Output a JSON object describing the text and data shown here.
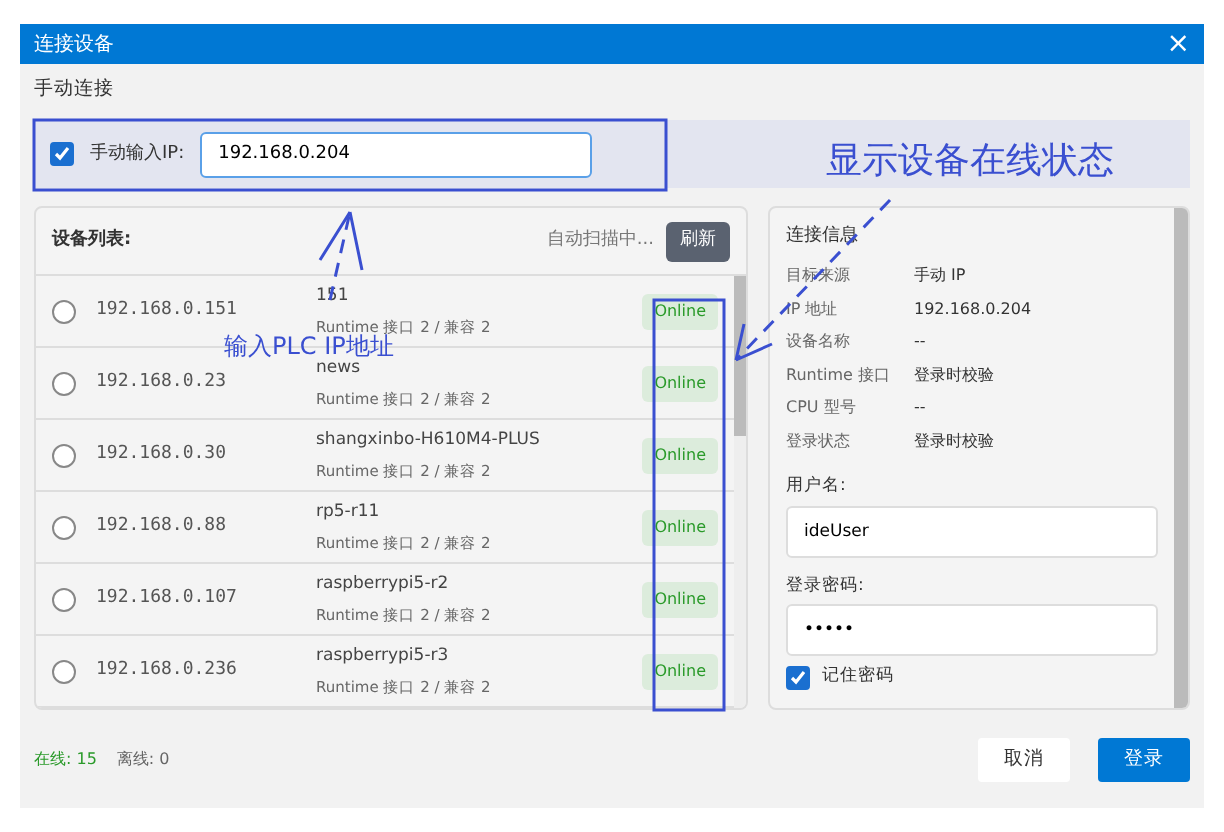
{
  "window": {
    "title": "连接设备",
    "close": "×"
  },
  "manual": {
    "heading": "手动连接",
    "checked": true,
    "label": "手动输入IP:",
    "value": "192.168.0.204"
  },
  "device_list": {
    "title": "设备列表:",
    "scan_status": "自动扫描中...",
    "refresh": "刷新",
    "devices": [
      {
        "ip": "192.168.0.151",
        "name": "151",
        "detail": "Runtime 接口 2 / 兼容 2",
        "status": "Online",
        "kind": "online",
        "selected": false
      },
      {
        "ip": "192.168.0.23",
        "name": "news",
        "detail": "Runtime 接口 2 / 兼容 2",
        "status": "Online",
        "kind": "online",
        "selected": false
      },
      {
        "ip": "192.168.0.30",
        "name": "shangxinbo-H610M4-PLUS",
        "detail": "Runtime 接口 2 / 兼容 2",
        "status": "Online",
        "kind": "online",
        "selected": false
      },
      {
        "ip": "192.168.0.88",
        "name": "rp5-r11",
        "detail": "Runtime 接口 2 / 兼容 2",
        "status": "Online",
        "kind": "online",
        "selected": false
      },
      {
        "ip": "192.168.0.107",
        "name": "raspberrypi5-r2",
        "detail": "Runtime 接口 2 / 兼容 2",
        "status": "Online",
        "kind": "online",
        "selected": false
      },
      {
        "ip": "192.168.0.236",
        "name": "raspberrypi5-r3",
        "detail": "Runtime 接口 2 / 兼容 2",
        "status": "Online",
        "kind": "online",
        "selected": false
      }
    ]
  },
  "connection_info": {
    "title": "连接信息",
    "rows": [
      {
        "key": "目标来源",
        "value": "手动 IP"
      },
      {
        "key": "IP 地址",
        "value": "192.168.0.204"
      },
      {
        "key": "设备名称",
        "value": "--"
      },
      {
        "key": "Runtime 接口",
        "value": "登录时校验"
      },
      {
        "key": "CPU 型号",
        "value": "--"
      },
      {
        "key": "登录状态",
        "value": "登录时校验"
      }
    ],
    "username_label": "用户名:",
    "username": "ideUser",
    "password_label": "登录密码:",
    "password": "•••••",
    "remember_label": "记住密码",
    "remember": true
  },
  "status_bar": {
    "online": "在线: 15",
    "offline": "离线: 0"
  },
  "buttons": [
    {
      "label": "取消",
      "kind": "secondary"
    },
    {
      "label": "登录",
      "kind": "primary"
    }
  ],
  "annotations": [
    {
      "text": "显示设备在线状态"
    },
    {
      "text": "输入PLC IP地址"
    }
  ]
}
